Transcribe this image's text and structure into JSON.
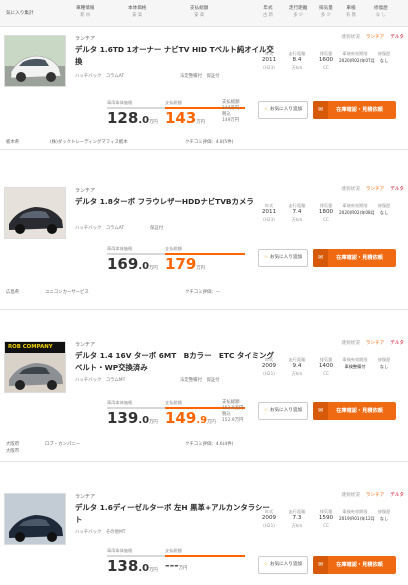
{
  "header": {
    "compare": "気に入り集計",
    "cols": [
      {
        "label": "車種情報",
        "sort": "新 ㊃"
      },
      {
        "label": "本体価格",
        "sort": "安 高"
      },
      {
        "label": "支払総額",
        "sort": "安 高"
      },
      {
        "label": "年式",
        "sort": "古 新"
      },
      {
        "label": "走行距離",
        "sort": "多 少"
      },
      {
        "label": "排気量",
        "sort": "多 少"
      },
      {
        "label": "車検",
        "sort": "有 無"
      },
      {
        "label": "修復歴",
        "sort": "な し"
      }
    ]
  },
  "listings": [
    {
      "maker": "ランチア",
      "title": "デルタ 1.6TD 1オーナー ナビTV HID Tベルト純オイル交換",
      "body": "ハッチバック",
      "mission": "コラムAT",
      "ac": "法定整備付",
      "warranty": "保証付",
      "status_k": "達到状況",
      "status_o": "ランチア",
      "status_r": "デルタ",
      "year": "2011",
      "year_jp": "(H23)",
      "mileage": "8.4",
      "mileage_unit": "万km",
      "cc": "1600",
      "cc_unit": "CC",
      "inspection": "2020(R02)年07月",
      "repair": "なし",
      "price_label": "車両本体価格",
      "price_int": "128",
      "price_dec": ".0",
      "price_unit": "万円",
      "total_label": "支払総額",
      "total_int": "143",
      "total_dec": "",
      "total_unit": "万円",
      "opt": [
        "支払総額",
        "144万円",
        "税込",
        "149万円"
      ],
      "fav": "お気に入り追加",
      "cta": "在庫確認・見積依頼",
      "dealer_region": "栃木県",
      "dealer_name": "(株)ダックトレーディングマフィス栃木",
      "review": "クチコミ評価：4.8(5件)"
    },
    {
      "maker": "ランチア",
      "title": "デルタ 1.8ターボ フラウレザーHDDナビTVBカメラ",
      "body": "ハッチバック",
      "mission": "コラムAT",
      "ac": "保証付",
      "warranty": "",
      "status_k": "達到状況",
      "status_o": "ランチア",
      "status_r": "デルタ",
      "year": "2011",
      "year_jp": "(H23)",
      "mileage": "7.4",
      "mileage_unit": "万km",
      "cc": "1800",
      "cc_unit": "CC",
      "inspection": "2020(R02)年08月",
      "repair": "なし",
      "price_label": "車両本体価格",
      "price_int": "169",
      "price_dec": ".0",
      "price_unit": "万円",
      "total_label": "支払総額",
      "total_int": "179",
      "total_dec": "",
      "total_unit": "万円",
      "opt": [],
      "fav": "お気に入り追加",
      "cta": "在庫確認・見積依頼",
      "dealer_region": "広島県",
      "dealer_name": "ユニコンカーサービス",
      "review": "クチコミ評価：—"
    },
    {
      "maker": "ランチア",
      "title": "デルタ 1.4 16V ターボ 6MT　Bカラー　ETC タイミングベルト・WP交換済み",
      "body": "ハッチバック",
      "mission": "コラムMT",
      "ac": "法定整備付",
      "warranty": "保証付",
      "status_k": "達到状況",
      "status_o": "ランチア",
      "status_r": "デルタ",
      "year": "2009",
      "year_jp": "(H21)",
      "mileage": "9.4",
      "mileage_unit": "万km",
      "cc": "1400",
      "cc_unit": "CC",
      "inspection": "車検整備付",
      "repair": "なし",
      "price_label": "車両本体価格",
      "price_int": "139",
      "price_dec": ".0",
      "price_unit": "万円",
      "total_label": "支払総額",
      "total_int": "149",
      "total_dec": ".9",
      "total_unit": "万円",
      "opt": [
        "支払総額",
        "153.9万円",
        "税込",
        "152.9万円"
      ],
      "fav": "お気に入り追加",
      "cta": "在庫確認・見積依頼",
      "dealer_region": "大阪府",
      "dealer_region2": "大阪市",
      "dealer_name": "ロブ・カンパニー",
      "review": "クチコミ評価：4.6(4件)",
      "banner": "ROB COMPANY"
    },
    {
      "maker": "ランチア",
      "title": "デルタ 1.6ディーゼルターボ 左H 黒革+アルカンタラシート",
      "body": "ハッチバック",
      "mission": "その他MT",
      "ac": "",
      "warranty": "",
      "status_k": "達到状況",
      "status_o": "ランチア",
      "status_r": "デルタ",
      "year": "2009",
      "year_jp": "(H21)",
      "mileage": "7.3",
      "mileage_unit": "万km",
      "cc": "1590",
      "cc_unit": "CC",
      "inspection": "2019(R01)年12月",
      "repair": "なし",
      "price_label": "車両本体価格",
      "price_int": "138",
      "price_dec": ".0",
      "price_unit": "万円",
      "total_label": "支払総額",
      "total_int": "---",
      "total_dec": "",
      "total_unit": "万円",
      "opt": [],
      "fav": "お気に入り追加",
      "cta": "在庫確認・見積依頼",
      "dealer_region": "",
      "dealer_name": "",
      "review": ""
    }
  ],
  "spec_labels": {
    "year": "年式",
    "mileage": "走行距離",
    "cc": "排気量",
    "inspection": "車検有効期限",
    "repair": "修復歴"
  },
  "colors": {
    "accent": "#f06a13",
    "total": "#ff6600",
    "status_red": "#d0021b"
  }
}
